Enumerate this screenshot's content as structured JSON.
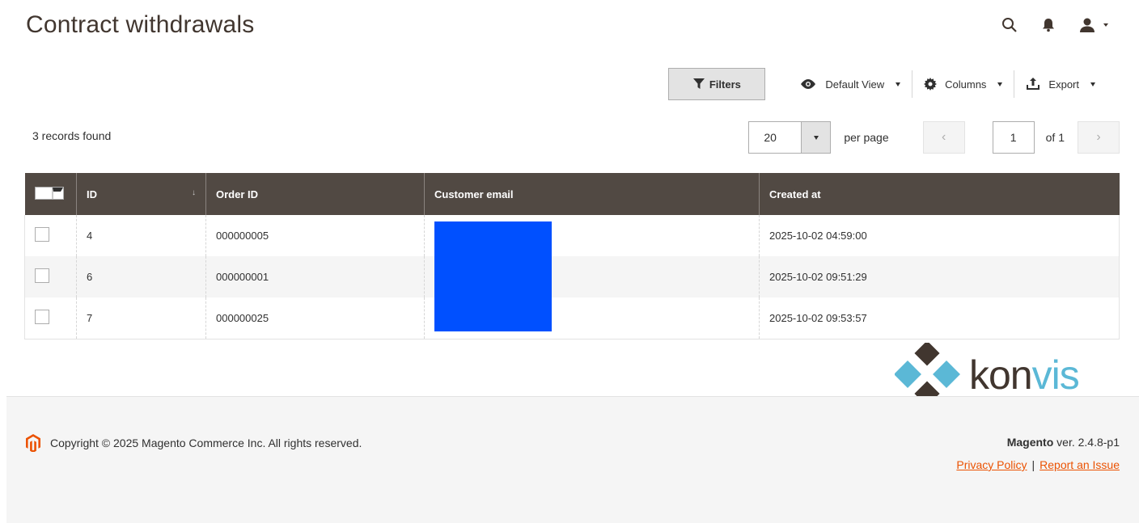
{
  "page": {
    "title": "Contract withdrawals"
  },
  "header": {
    "icons": [
      "search-icon",
      "bell-icon",
      "user-icon"
    ]
  },
  "toolbar": {
    "filters_label": "Filters",
    "view_label": "Default View",
    "columns_label": "Columns",
    "export_label": "Export"
  },
  "grid": {
    "records_found": "3 records found",
    "per_page_value": "20",
    "per_page_label": "per page",
    "current_page": "1",
    "of_pages": "of 1",
    "columns": [
      "ID",
      "Order ID",
      "Customer email",
      "Created at"
    ],
    "rows": [
      {
        "id": "4",
        "order_id": "000000005",
        "customer_email": "",
        "created_at": "2025-10-02 04:59:00"
      },
      {
        "id": "6",
        "order_id": "000000001",
        "customer_email": "",
        "created_at": "2025-10-02 09:51:29"
      },
      {
        "id": "7",
        "order_id": "000000025",
        "customer_email": "",
        "created_at": "2025-10-02 09:53:57"
      }
    ]
  },
  "brand": {
    "logo_part1": "kon",
    "logo_part2": "vis"
  },
  "footer": {
    "copyright": "Copyright © 2025 Magento Commerce Inc. All rights reserved.",
    "version_brand": "Magento",
    "version_text": " ver. 2.4.8-p1",
    "privacy_link": "Privacy Policy",
    "separator": "|",
    "report_link": "Report an Issue"
  },
  "colors": {
    "accent": "#eb5202",
    "header_bg": "#514943",
    "mask": "#0050ff"
  }
}
